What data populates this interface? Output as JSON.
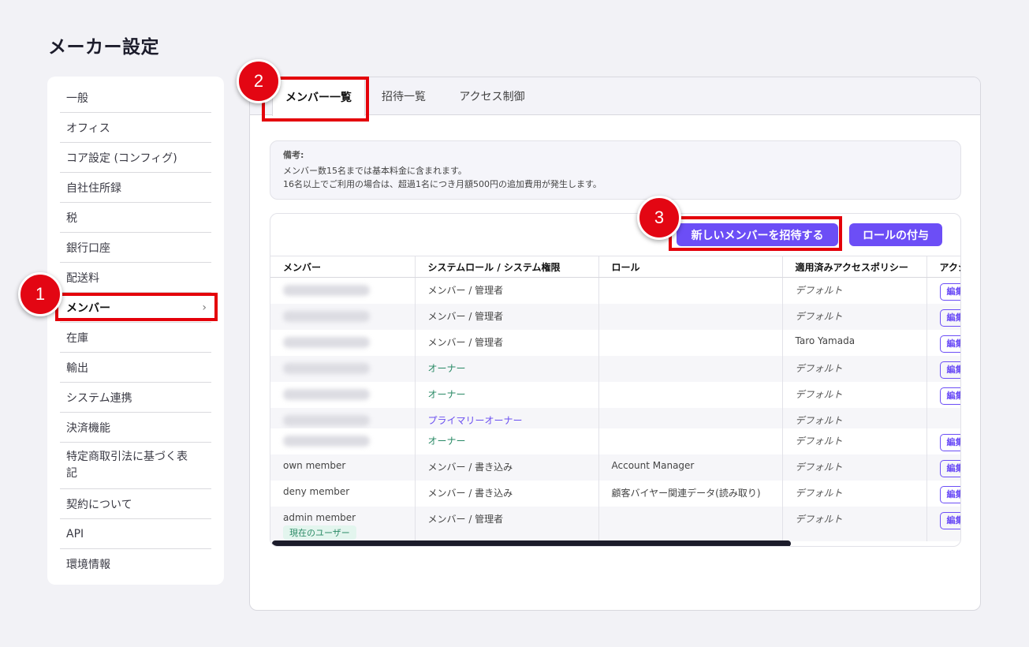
{
  "page_title": "メーカー設定",
  "sidebar": {
    "items": [
      {
        "label": "一般"
      },
      {
        "label": "オフィス"
      },
      {
        "label": "コア設定 (コンフィグ)"
      },
      {
        "label": "自社住所録"
      },
      {
        "label": "税"
      },
      {
        "label": "銀行口座"
      },
      {
        "label": "配送料"
      },
      {
        "label": "メンバー",
        "active": true,
        "chevron": "›"
      },
      {
        "label": "在庫"
      },
      {
        "label": "輸出"
      },
      {
        "label": "システム連携"
      },
      {
        "label": "決済機能"
      },
      {
        "label": "特定商取引法に基づく表記"
      },
      {
        "label": "契約について"
      },
      {
        "label": "API"
      },
      {
        "label": "環境情報"
      }
    ]
  },
  "tabs": [
    {
      "label": "メンバー一覧",
      "active": true
    },
    {
      "label": "招待一覧"
    },
    {
      "label": "アクセス制御"
    }
  ],
  "note": {
    "heading": "備考:",
    "line1": "メンバー数15名までは基本料金に含まれます。",
    "line2": "16名以上でご利用の場合は、超過1名につき月額500円の追加費用が発生します。"
  },
  "actions": {
    "invite_label": "新しいメンバーを招待する",
    "assign_role_label": "ロールの付与"
  },
  "table": {
    "headers": [
      "メンバー",
      "システムロール / システム権限",
      "ロール",
      "適用済みアクセスポリシー",
      "アクション"
    ],
    "edit_label": "編集",
    "current_user_badge": "現在のユーザー",
    "rows": [
      {
        "member": "",
        "system_role": "メンバー / 管理者",
        "role": "",
        "policy": "デフォルト",
        "edit": true
      },
      {
        "member": "",
        "system_role": "メンバー / 管理者",
        "role": "",
        "policy": "デフォルト",
        "edit": true
      },
      {
        "member": "",
        "system_role": "メンバー / 管理者",
        "role": "",
        "policy": "Taro Yamada",
        "edit": true
      },
      {
        "member": "",
        "system_role": "オーナー",
        "role": "",
        "policy": "デフォルト",
        "edit": true
      },
      {
        "member": "",
        "system_role": "オーナー",
        "role": "",
        "policy": "デフォルト",
        "edit": true
      },
      {
        "member": "",
        "system_role": "プライマリーオーナー",
        "role": "",
        "policy": "デフォルト",
        "edit": false
      },
      {
        "member": "",
        "system_role": "オーナー",
        "role": "",
        "policy": "デフォルト",
        "edit": true
      },
      {
        "member": "own member",
        "system_role": "メンバー / 書き込み",
        "role": "Account Manager",
        "policy": "デフォルト",
        "edit": true
      },
      {
        "member": "deny member",
        "system_role": "メンバー / 書き込み",
        "role": "顧客バイヤー関連データ(読み取り)",
        "policy": "デフォルト",
        "edit": true
      },
      {
        "member": "admin member",
        "system_role": "メンバー / 管理者",
        "role": "",
        "policy": "デフォルト",
        "edit": true
      }
    ]
  },
  "annotations": [
    "1",
    "2",
    "3"
  ],
  "colors": {
    "accent": "#6c4ef6",
    "highlight": "#e4000a",
    "owner": "#2a8a66"
  }
}
